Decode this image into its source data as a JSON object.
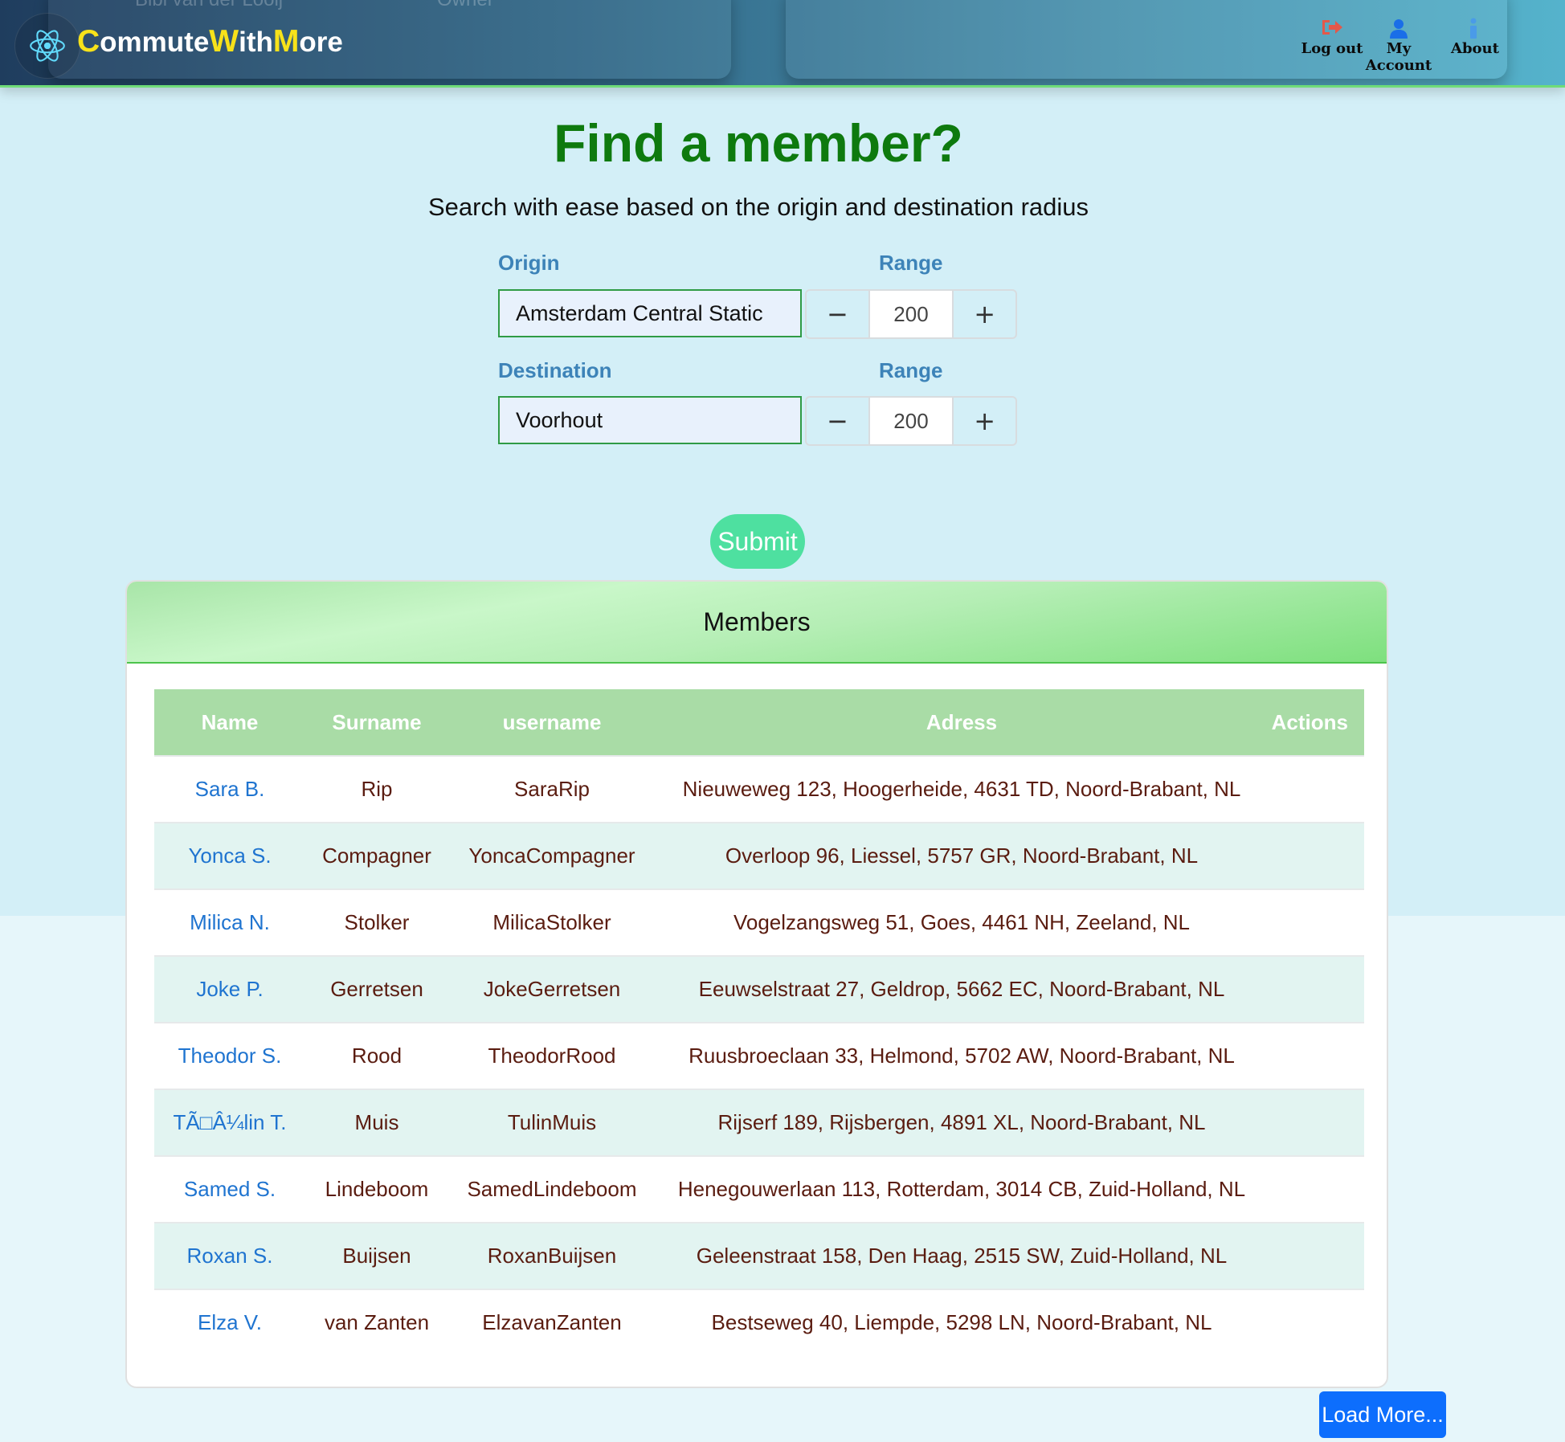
{
  "header": {
    "brand": {
      "c1": "C",
      "t1": "ommute",
      "c2": "W",
      "t2": "ith",
      "c3": "M",
      "t3": "ore"
    },
    "ghost_left_1": "Bibi van der Looij",
    "ghost_left_2": "Owner",
    "nav": [
      {
        "label": "Log out",
        "icon": "logout-icon",
        "color": "#e4584a"
      },
      {
        "label": "My Account",
        "icon": "user-icon",
        "color": "#1a6ee8"
      },
      {
        "label": "About",
        "icon": "info-icon",
        "color": "#4a9be8"
      }
    ]
  },
  "hero": {
    "title": "Find a member?",
    "subtitle": "Search with ease based on the origin and destination radius"
  },
  "search": {
    "origin_label": "Origin",
    "origin_value": "Amsterdam Central Static",
    "origin_range_label": "Range",
    "origin_range": "200",
    "destination_label": "Destination",
    "destination_value": "Voorhout",
    "destination_range_label": "Range",
    "destination_range": "200",
    "minus": "−",
    "plus": "+",
    "submit": "Submit"
  },
  "members": {
    "title": "Members",
    "columns": [
      "Name",
      "Surname",
      "username",
      "Adress",
      "Actions"
    ],
    "rows": [
      [
        "Sara B.",
        "Rip",
        "SaraRip",
        "Nieuweweg 123, Hoogerheide, 4631 TD, Noord-Brabant, NL"
      ],
      [
        "Yonca S.",
        "Compagner",
        "YoncaCompagner",
        "Overloop 96, Liessel, 5757 GR, Noord-Brabant, NL"
      ],
      [
        "Milica N.",
        "Stolker",
        "MilicaStolker",
        "Vogelzangsweg 51, Goes, 4461 NH, Zeeland, NL"
      ],
      [
        "Joke P.",
        "Gerretsen",
        "JokeGerretsen",
        "Eeuwselstraat 27, Geldrop, 5662 EC, Noord-Brabant, NL"
      ],
      [
        "Theodor S.",
        "Rood",
        "TheodorRood",
        "Ruusbroeclaan 33, Helmond, 5702 AW, Noord-Brabant, NL"
      ],
      [
        "TÃ□Â¼lin T.",
        "Muis",
        "TulinMuis",
        "Rijserf 189, Rijsbergen, 4891 XL, Noord-Brabant, NL"
      ],
      [
        "Samed S.",
        "Lindeboom",
        "SamedLindeboom",
        "Henegouwerlaan 113, Rotterdam, 3014 CB, Zuid-Holland, NL"
      ],
      [
        "Roxan S.",
        "Buijsen",
        "RoxanBuijsen",
        "Geleenstraat 158, Den Haag, 2515 SW, Zuid-Holland, NL"
      ],
      [
        "Elza V.",
        "van Zanten",
        "ElzavanZanten",
        "Bestseweg 40, Liempde, 5298 LN, Noord-Brabant, NL"
      ]
    ]
  },
  "load_more": "Load More...",
  "colors": {
    "title_green": "#0e7a0e",
    "label_blue": "#3d83b8",
    "brand_yellow": "#f7e21a",
    "submit_green": "#4ee0a0",
    "load_more_blue": "#0d6efd",
    "name_link_blue": "#1f74d0"
  }
}
